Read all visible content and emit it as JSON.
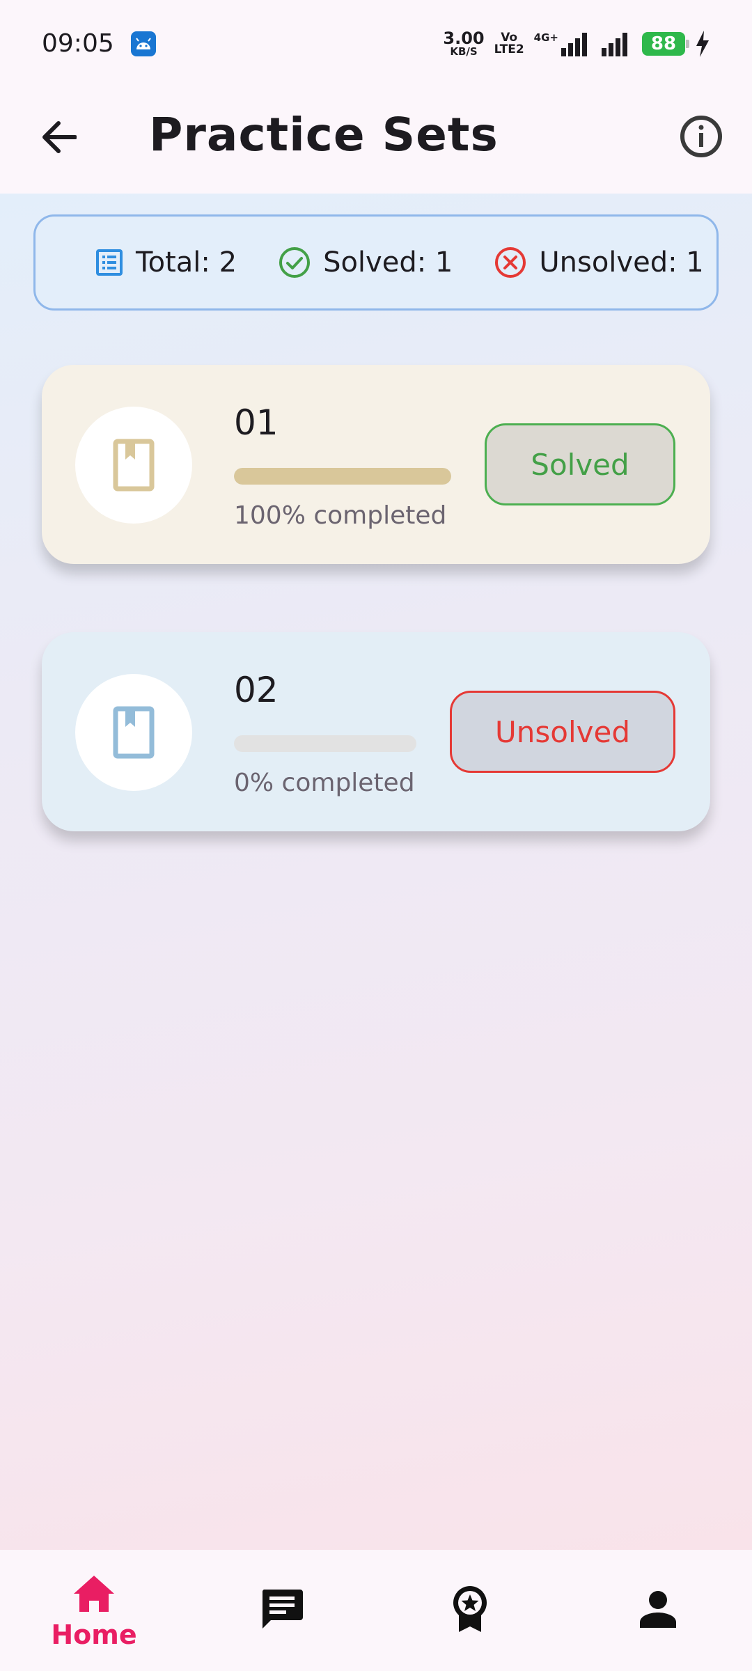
{
  "status_bar": {
    "time": "09:05",
    "net_speed_value": "3.00",
    "net_speed_unit": "KB/S",
    "volte_top": "Vo",
    "volte_bottom": "LTE2",
    "network_type": "4G+",
    "battery": "88"
  },
  "app_bar": {
    "title": "Practice Sets",
    "back_icon": "arrow-back-icon",
    "info_icon": "info-icon"
  },
  "summary": {
    "total_label": "Total: 2",
    "solved_label": "Solved: 1",
    "unsolved_label": "Unsolved: 1",
    "colors": {
      "total": "#2f8ee0",
      "solved": "#43a047",
      "unsolved": "#e53935"
    }
  },
  "sets": [
    {
      "number": "01",
      "progress_fraction": 1.0,
      "progress_text": "100% completed",
      "status": "Solved",
      "icon": "book-bookmark-icon",
      "icon_color": "#d9c79a"
    },
    {
      "number": "02",
      "progress_fraction": 0.0,
      "progress_text": "0% completed",
      "status": "Unsolved",
      "icon": "book-bookmark-icon",
      "icon_color": "#93bcd9"
    }
  ],
  "bottom_nav": {
    "items": [
      {
        "label": "Home",
        "icon": "home-icon",
        "active": true
      },
      {
        "label": "",
        "icon": "chat-icon",
        "active": false
      },
      {
        "label": "",
        "icon": "award-icon",
        "active": false
      },
      {
        "label": "",
        "icon": "person-icon",
        "active": false
      }
    ],
    "active_color": "#e91e63"
  }
}
